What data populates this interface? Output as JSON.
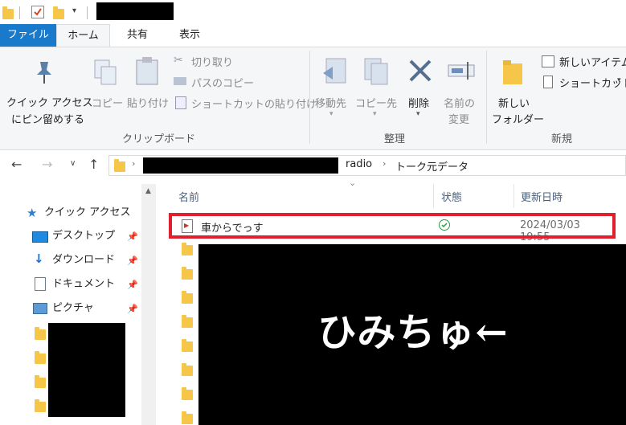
{
  "ribbon_tabs": [
    "ファイル",
    "ホーム",
    "共有",
    "表示"
  ],
  "clipboard": {
    "pin_quick_access": [
      "クイック アクセス",
      "にピン留めする"
    ],
    "copy": "コピー",
    "paste": "貼り付け",
    "cut": "切り取り",
    "copy_path": "パスのコピー",
    "paste_shortcut": "ショートカットの貼り付け",
    "group_label": "クリップボード"
  },
  "organize": {
    "move_to": "移動先",
    "copy_to": "コピー先",
    "delete": "削除",
    "rename": [
      "名前の",
      "変更"
    ],
    "group_label": "整理"
  },
  "new": {
    "new_folder": [
      "新しい",
      "フォルダー"
    ],
    "new_item": "新しいアイテム",
    "easy_access": "ショートカット",
    "group_label": "新規"
  },
  "address": {
    "segments": [
      "radio",
      "トーク元データ"
    ]
  },
  "nav_pane": {
    "quick_access": "クイック アクセス",
    "items": [
      "デスクトップ",
      "ダウンロード",
      "ドキュメント",
      "ピクチャ"
    ]
  },
  "columns": {
    "name": "名前",
    "status": "状態",
    "modified": "更新日時"
  },
  "files": [
    {
      "name": "車からでっす",
      "status_icon": "sync-ok-icon",
      "modified": "2024/03/03 19:55"
    }
  ],
  "overlay_caption": "ひみちゅ←",
  "colors": {
    "file_tab": "#1979ca",
    "highlight": "#e0202c",
    "status_ok": "#2d9a45"
  }
}
